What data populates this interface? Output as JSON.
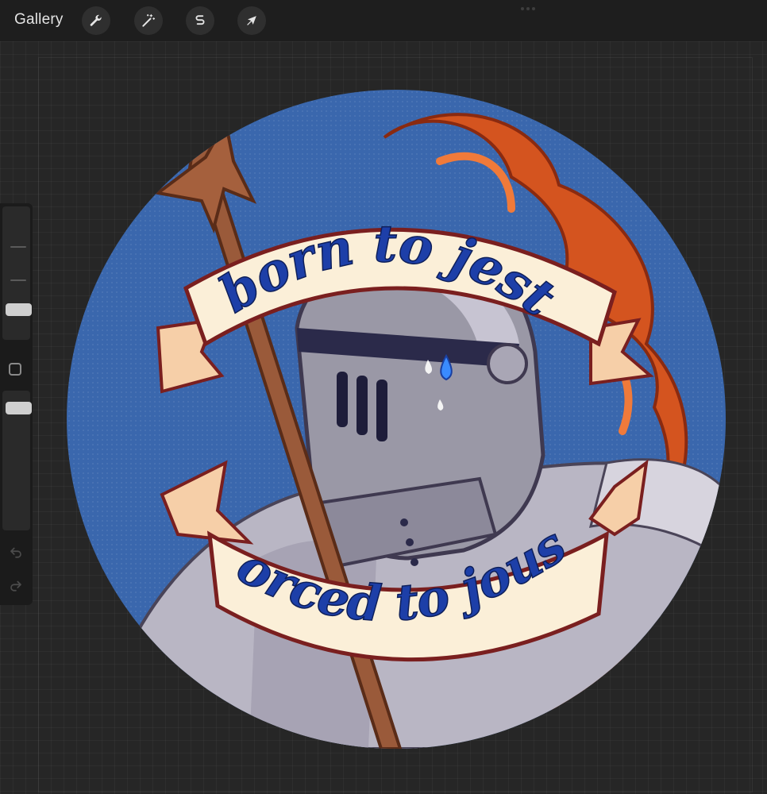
{
  "topbar": {
    "gallery_label": "Gallery",
    "tools": [
      {
        "icon": "wrench-icon",
        "name": "actions"
      },
      {
        "icon": "magic-wand-icon",
        "name": "adjustments"
      },
      {
        "icon": "selection-s-icon",
        "name": "selection"
      },
      {
        "icon": "arrow-cursor-icon",
        "name": "transform"
      }
    ]
  },
  "artwork": {
    "banner_top": "born to jest",
    "banner_bottom": "forced to joust",
    "colors": {
      "background_blue": "#3a67ad",
      "banner_cream": "#fbefd8",
      "banner_outline": "#7a1f1f",
      "lettering_blue": "#1d3fa8",
      "helmet_gray": "#9a98a6",
      "plume_orange": "#d4541f",
      "spear_brown": "#9a5a3a"
    }
  },
  "sidebar": {
    "icons": [
      "modify-button-icon",
      "undo-icon",
      "redo-icon"
    ]
  }
}
